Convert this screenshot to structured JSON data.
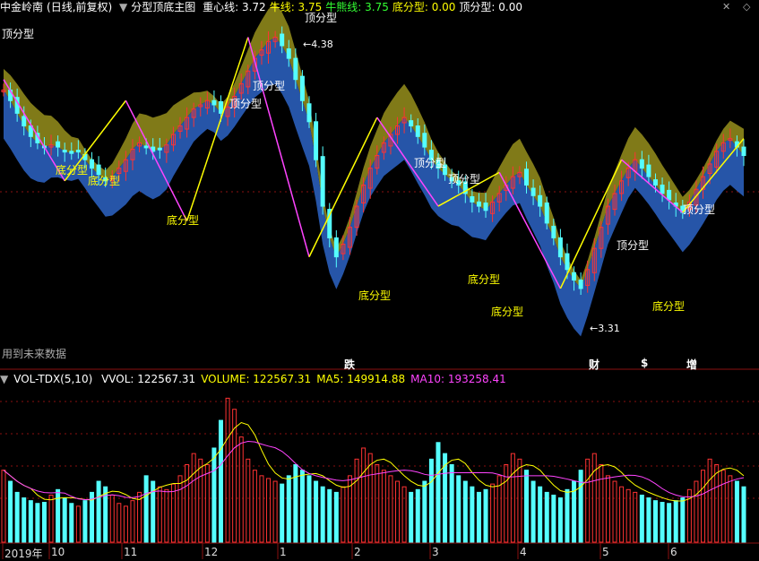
{
  "header": {
    "stock": "中金岭南",
    "mode": "(日线,前复权)",
    "indicator": "分型顶底主图",
    "items": [
      {
        "label": "重心线:",
        "value": "3.72",
        "color": "#ffffff"
      },
      {
        "label": "牛线:",
        "value": "3.75",
        "color": "#ffff00"
      },
      {
        "label": "牛熊线:",
        "value": "3.75",
        "color": "#33ff33"
      },
      {
        "label": "底分型:",
        "value": "0.00",
        "color": "#ffff00"
      },
      {
        "label": "顶分型:",
        "value": "0.00",
        "color": "#ffffff"
      }
    ],
    "corner_icons": [
      "close-icon",
      "diamond-icon"
    ]
  },
  "note": "用到未来数据",
  "events": [
    {
      "label": "跌",
      "color": "#33ff33"
    },
    {
      "label": "财",
      "color": "#66aaff"
    },
    {
      "label": "$",
      "color": "#ff3333"
    },
    {
      "label": "增",
      "color": "#ffffff"
    }
  ],
  "volume_header": {
    "name": "VOL-TDX(5,10)",
    "items": [
      {
        "label": "VVOL:",
        "value": "122567.31",
        "color": "#ffffff"
      },
      {
        "label": "VOLUME:",
        "value": "122567.31",
        "color": "#ffff00"
      },
      {
        "label": "MA5:",
        "value": "149914.88",
        "color": "#ffff00"
      },
      {
        "label": "MA10:",
        "value": "193258.41",
        "color": "#ff44ff"
      }
    ]
  },
  "x_axis": [
    "2019年",
    "10",
    "11",
    "12",
    "1",
    "2",
    "3",
    "4",
    "5",
    "6"
  ],
  "colors": {
    "up": "#ff3333",
    "down": "#55ffff",
    "band_upper": "#807a18",
    "band_lower": "#2655a8",
    "zigzag_up": "#ffff00",
    "zigzag_down": "#ff44ff",
    "grid": "#8a1010"
  },
  "chart_data": [
    {
      "type": "candlestick",
      "title": "分型顶底主图",
      "annotations": [
        {
          "text": "顶分型",
          "kind": "top"
        },
        {
          "text": "底分型",
          "kind": "bottom"
        },
        {
          "text": "底分型",
          "kind": "bottom"
        },
        {
          "text": "底分型",
          "kind": "bottom"
        },
        {
          "text": "顶分型",
          "kind": "top"
        },
        {
          "text": "顶分型",
          "kind": "top"
        },
        {
          "text": "顶分型",
          "kind": "top"
        },
        {
          "text": "底分型",
          "kind": "bottom"
        },
        {
          "text": "顶分型",
          "kind": "top"
        },
        {
          "text": "顶分型",
          "kind": "top"
        },
        {
          "text": "底分型",
          "kind": "bottom"
        },
        {
          "text": "底分型",
          "kind": "bottom"
        },
        {
          "text": "顶分型",
          "kind": "top"
        },
        {
          "text": "底分型",
          "kind": "bottom"
        },
        {
          "text": "顶分型",
          "kind": "top"
        }
      ],
      "price_marks": [
        "4.38",
        "3.31"
      ],
      "zigzag": [
        4.3,
        3.82,
        4.2,
        3.63,
        4.5,
        3.46,
        4.12,
        3.7,
        3.86,
        3.31,
        3.92,
        3.67,
        4.02
      ],
      "close_path": [
        4.25,
        4.2,
        4.14,
        4.08,
        4.03,
        4.0,
        3.98,
        3.99,
        3.98,
        3.96,
        3.95,
        3.96,
        3.92,
        3.88,
        3.85,
        3.82,
        3.84,
        3.88,
        3.92,
        3.97,
        4.0,
        3.98,
        3.96,
        3.97,
        3.99,
        4.04,
        4.08,
        4.12,
        4.16,
        4.18,
        4.2,
        4.18,
        4.14,
        4.17,
        4.22,
        4.28,
        4.34,
        4.4,
        4.44,
        4.48,
        4.5,
        4.46,
        4.4,
        4.3,
        4.2,
        4.1,
        3.92,
        3.7,
        3.55,
        3.46,
        3.52,
        3.6,
        3.7,
        3.8,
        3.88,
        3.94,
        4.0,
        4.04,
        4.08,
        4.12,
        4.08,
        4.03,
        3.98,
        3.92,
        3.88,
        3.85,
        3.82,
        3.8,
        3.76,
        3.72,
        3.7,
        3.68,
        3.72,
        3.76,
        3.8,
        3.84,
        3.86,
        3.8,
        3.75,
        3.7,
        3.62,
        3.55,
        3.46,
        3.4,
        3.35,
        3.31,
        3.4,
        3.5,
        3.6,
        3.7,
        3.76,
        3.82,
        3.88,
        3.92,
        3.88,
        3.84,
        3.8,
        3.76,
        3.73,
        3.7,
        3.67,
        3.72,
        3.78,
        3.84,
        3.9,
        3.96,
        4.0,
        4.02,
        3.98,
        3.94
      ],
      "volume_path": [
        130,
        110,
        90,
        80,
        75,
        70,
        72,
        85,
        95,
        80,
        70,
        65,
        75,
        90,
        110,
        100,
        85,
        70,
        65,
        75,
        90,
        120,
        110,
        100,
        95,
        105,
        120,
        140,
        160,
        150,
        140,
        170,
        220,
        260,
        240,
        190,
        150,
        130,
        120,
        115,
        110,
        105,
        120,
        140,
        130,
        120,
        110,
        100,
        95,
        90,
        100,
        120,
        150,
        170,
        160,
        140,
        130,
        120,
        110,
        100,
        90,
        95,
        110,
        150,
        180,
        160,
        140,
        120,
        110,
        100,
        90,
        95,
        105,
        120,
        140,
        160,
        150,
        130,
        110,
        100,
        90,
        85,
        80,
        95,
        110,
        130,
        150,
        160,
        140,
        120,
        110,
        100,
        95,
        90,
        85,
        80,
        75,
        72,
        70,
        75,
        80,
        95,
        110,
        130,
        150,
        140,
        130,
        120,
        110,
        100
      ],
      "ylim": [
        3.0,
        4.6
      ]
    },
    {
      "type": "bar",
      "title": "VOL-TDX(5,10)",
      "series": [
        {
          "name": "VOLUME"
        },
        {
          "name": "MA5"
        },
        {
          "name": "MA10"
        }
      ],
      "last_values": {
        "VVOL": 122567.31,
        "VOLUME": 122567.31,
        "MA5": 149914.88,
        "MA10": 193258.41
      }
    }
  ]
}
